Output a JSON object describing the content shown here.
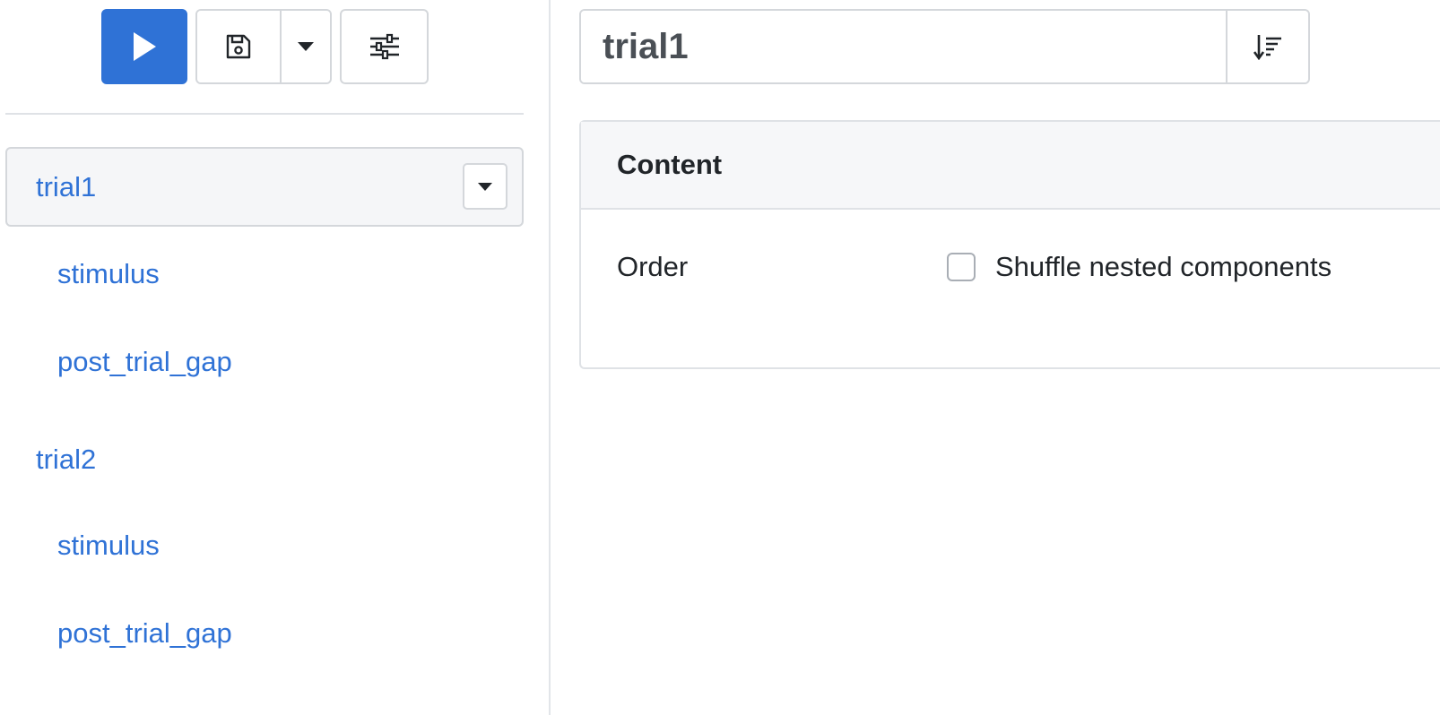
{
  "toolbar": {
    "run_icon": "play-icon",
    "save_icon": "floppy-disk-icon",
    "dropdown_icon": "caret-down-icon",
    "settings_icon": "sliders-icon",
    "accent_color": "#2f72d6"
  },
  "sidebar": {
    "items": [
      {
        "label": "trial1",
        "level": 0,
        "selected": true
      },
      {
        "label": "stimulus",
        "level": 1
      },
      {
        "label": "post_trial_gap",
        "level": 1
      },
      {
        "label": "trial2",
        "level": 0
      },
      {
        "label": "stimulus",
        "level": 1
      },
      {
        "label": "post_trial_gap",
        "level": 1
      }
    ]
  },
  "main": {
    "name_value": "trial1",
    "sort_icon": "sort-descending-icon",
    "panel": {
      "header": "Content",
      "order_label": "Order",
      "shuffle_label": "Shuffle nested components",
      "shuffle_checked": false
    }
  }
}
